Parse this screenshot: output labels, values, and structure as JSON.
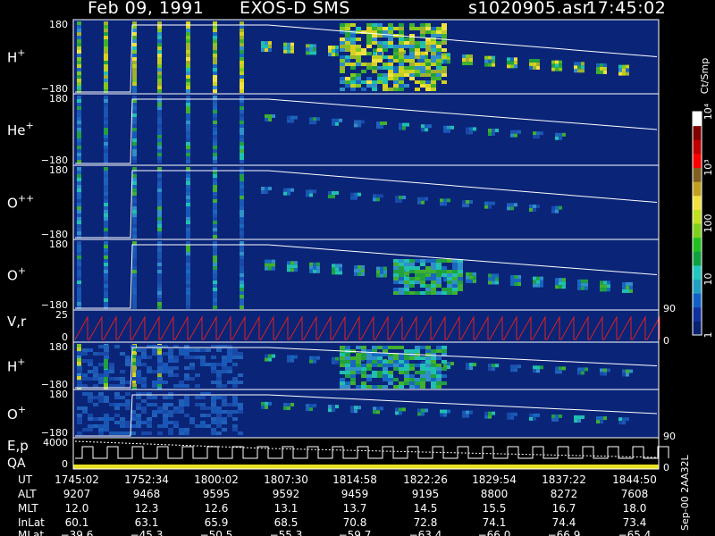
{
  "header": {
    "date": "Feb 09, 1991",
    "instrument": "EXOS-D SMS",
    "file": "s1020905.asr",
    "time": "17:45:02"
  },
  "colorbar": {
    "label": "Ct/Smp",
    "ticks": [
      "1",
      "10",
      "100",
      "10³",
      "10⁴"
    ],
    "colors": [
      "#0a2070",
      "#1030a0",
      "#1060c8",
      "#20a0c0",
      "#20c8c0",
      "#10a040",
      "#20c020",
      "#80d020",
      "#c0e020",
      "#f0e040",
      "#c0a020",
      "#806020",
      "#ff0000",
      "#c00000",
      "#800000",
      "#ffffff"
    ]
  },
  "panels": [
    {
      "label": "H",
      "sup": "+",
      "ymax": "180",
      "ymin": "−180"
    },
    {
      "label": "He",
      "sup": "+",
      "ymax": "180",
      "ymin": "−180"
    },
    {
      "label": "O",
      "sup": "++",
      "ymax": "180",
      "ymin": "−180"
    },
    {
      "label": "O",
      "sup": "+",
      "ymax": "180",
      "ymin": "−180",
      "right_tick": "90"
    },
    {
      "label": "V,r",
      "sup": "",
      "ymax": "25",
      "ymin": "0",
      "right_tick": "0"
    },
    {
      "label": "H",
      "sup": "+",
      "ymax": "180",
      "ymin": "−180"
    },
    {
      "label": "O",
      "sup": "+",
      "ymax": "180",
      "ymin": "−180",
      "right_tick": "90"
    },
    {
      "label": "E,p",
      "sup": "",
      "ymax": "4000",
      "ymin": "0",
      "right_tick": "0",
      "label2": "QA"
    }
  ],
  "footer": {
    "side_label": "Sep-00  2AA32L",
    "rows": [
      {
        "name": "UT",
        "values": [
          "1745:02",
          "1752:34",
          "1800:02",
          "1807:30",
          "1814:58",
          "1822:26",
          "1829:54",
          "1837:22",
          "1844:50"
        ]
      },
      {
        "name": "ALT",
        "values": [
          "9207",
          "9468",
          "9595",
          "9592",
          "9459",
          "9195",
          "8800",
          "8272",
          "7608"
        ]
      },
      {
        "name": "MLT",
        "values": [
          "12.0",
          "12.3",
          "12.6",
          "13.1",
          "13.7",
          "14.5",
          "15.5",
          "16.7",
          "18.0"
        ]
      },
      {
        "name": "InLat",
        "values": [
          "60.1",
          "63.1",
          "65.9",
          "68.5",
          "70.8",
          "72.8",
          "74.1",
          "74.4",
          "73.4"
        ]
      },
      {
        "name": "MLat",
        "values": [
          "−39.6",
          "−45.3",
          "−50.5",
          "−55.3",
          "−59.7",
          "−63.4",
          "−66.0",
          "−66.9",
          "−65.4"
        ]
      }
    ]
  },
  "chart_data": {
    "type": "heatmap",
    "title": "Feb 09, 1991   EXOS-D SMS",
    "xlabel": "UT",
    "x_ticks": [
      "1745:02",
      "1752:34",
      "1800:02",
      "1807:30",
      "1814:58",
      "1822:26",
      "1829:54",
      "1837:22",
      "1844:50"
    ],
    "colorbar_label": "Ct/Smp",
    "colorbar_scale": "log",
    "colorbar_range": [
      1,
      10000
    ],
    "panels": [
      "H+",
      "He+",
      "O++",
      "O+",
      "V,r",
      "H+",
      "O+",
      "E,p / QA"
    ],
    "pitch_angle_range": [
      -180,
      180
    ]
  }
}
